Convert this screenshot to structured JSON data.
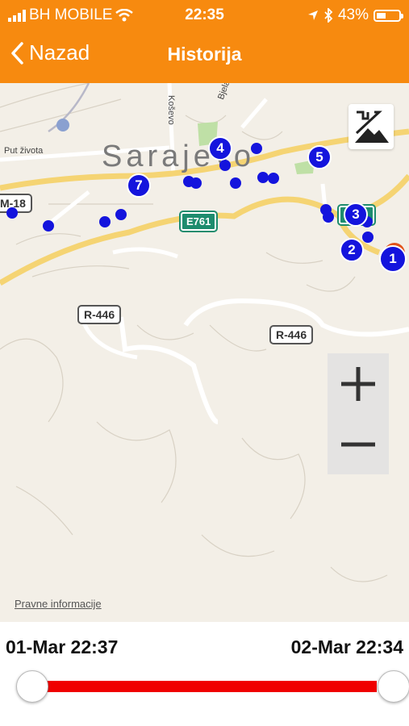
{
  "status_bar": {
    "carrier": "BH MOBILE",
    "time": "22:35",
    "battery": "43%",
    "battery_level": 0.43
  },
  "nav": {
    "back_label": "Nazad",
    "title": "Historija"
  },
  "map": {
    "city_label": "Sarajevo",
    "road_labels": [
      "Put života",
      "Koševo",
      "Bjela"
    ],
    "shields": [
      "M-18",
      "R-446",
      "R-446"
    ],
    "e_shields": [
      "E761",
      "E761"
    ],
    "markers": [
      "1",
      "2",
      "3",
      "4",
      "5",
      "7"
    ],
    "legal_link": "Pravne informacije",
    "zoom_in": "+",
    "zoom_out": "−",
    "icons": [
      "map-type-icon"
    ]
  },
  "range": {
    "start": "01-Mar 22:37",
    "end": "02-Mar 22:34",
    "start_fraction": 0.0,
    "end_fraction": 1.0
  },
  "colors": {
    "accent": "#f78a0f",
    "marker": "#1414dd",
    "range_track": "#f00000"
  }
}
